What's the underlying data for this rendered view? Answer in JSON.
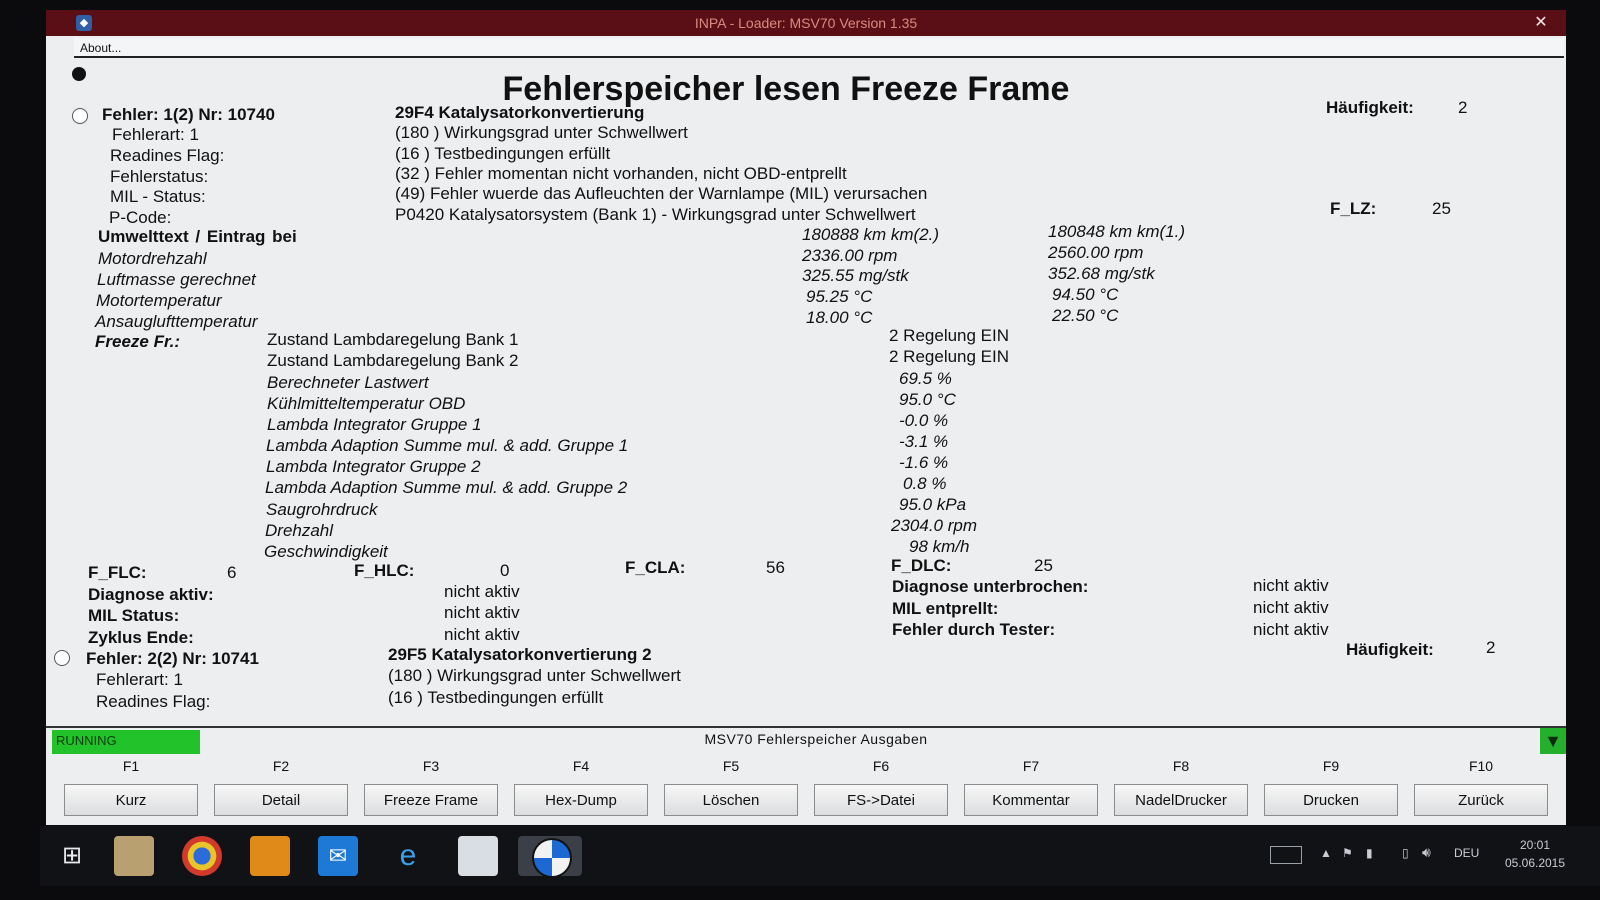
{
  "window": {
    "title": "INPA - Loader: MSV70 Version 1.35",
    "menu": {
      "about": "About..."
    }
  },
  "page_title": "Fehlerspeicher lesen Freeze Frame",
  "fault1": {
    "header": "Fehler: 1(2) Nr: 10740",
    "code_text": "29F4 Katalysatorkonvertierung",
    "haeufigkeit_label": "Häufigkeit:",
    "haeufigkeit_value": "2",
    "flz_label": "F_LZ:",
    "flz_value": "25",
    "rows": [
      {
        "label": "Fehlerart: 1",
        "value": "(180 ) Wirkungsgrad unter Schwellwert"
      },
      {
        "label": "Readines Flag:",
        "value": "(16 ) Testbedingungen erfüllt"
      },
      {
        "label": "Fehlerstatus:",
        "value": "(32 ) Fehler momentan nicht vorhanden, nicht OBD-entprellt"
      },
      {
        "label": "MIL - Status:",
        "value": "(49) Fehler wuerde das Aufleuchten der Warnlampe (MIL) verursachen"
      },
      {
        "label": "P-Code:",
        "value": "P0420 Katalysatorsystem (Bank 1) - Wirkungsgrad unter Schwellwert"
      }
    ],
    "umwelt_header": "Umwelttext  /  Eintrag bei",
    "km_col1": "180888 km km(2.)",
    "km_col2": "180848 km km(1.)",
    "umwelt": [
      {
        "label": "Motordrehzahl",
        "v1": "2336.00 rpm",
        "v2": "2560.00 rpm"
      },
      {
        "label": "Luftmasse gerechnet",
        "v1": "325.55 mg/stk",
        "v2": "352.68 mg/stk"
      },
      {
        "label": "Motortemperatur",
        "v1": "95.25 °C",
        "v2": "94.50 °C"
      },
      {
        "label": "Ansauglufttemperatur",
        "v1": "18.00 °C",
        "v2": "22.50 °C"
      }
    ],
    "freeze_label": "Freeze Fr.:",
    "freeze": [
      {
        "label": "Zustand Lambdaregelung Bank 1",
        "value": "2 Regelung EIN",
        "italic": false
      },
      {
        "label": "Zustand Lambdaregelung Bank 2",
        "value": "2 Regelung EIN",
        "italic": false
      },
      {
        "label": "Berechneter Lastwert",
        "value": "69.5 %",
        "italic": true
      },
      {
        "label": "Kühlmitteltemperatur OBD",
        "value": "95.0 °C",
        "italic": true
      },
      {
        "label": "Lambda Integrator Gruppe 1",
        "value": "-0.0 %",
        "italic": true
      },
      {
        "label": "Lambda Adaption Summe mul. & add. Gruppe 1",
        "value": "-3.1 %",
        "italic": true
      },
      {
        "label": "Lambda Integrator Gruppe 2",
        "value": "-1.6 %",
        "italic": true
      },
      {
        "label": "Lambda Adaption Summe mul. & add. Gruppe 2",
        "value": "0.8 %",
        "italic": true
      },
      {
        "label": "Saugrohrdruck",
        "value": "95.0 kPa",
        "italic": true
      },
      {
        "label": "Drehzahl",
        "value": "2304.0 rpm",
        "italic": true
      },
      {
        "label": "Geschwindigkeit",
        "value": "98 km/h",
        "italic": true
      }
    ],
    "counters": {
      "flc_label": "F_FLC:",
      "flc_value": "6",
      "hlc_label": "F_HLC:",
      "hlc_value": "0",
      "cla_label": "F_CLA:",
      "cla_value": "56",
      "dlc_label": "F_DLC:",
      "dlc_value": "25"
    },
    "status_left": [
      {
        "label": "Diagnose aktiv:",
        "value": "nicht aktiv"
      },
      {
        "label": "MIL Status:",
        "value": "nicht aktiv"
      },
      {
        "label": "Zyklus Ende:",
        "value": "nicht aktiv"
      }
    ],
    "status_right": [
      {
        "label": "Diagnose unterbrochen:",
        "value": "nicht aktiv"
      },
      {
        "label": "MIL entprellt:",
        "value": "nicht aktiv"
      },
      {
        "label": "Fehler durch Tester:",
        "value": "nicht aktiv"
      }
    ]
  },
  "fault2": {
    "header": "Fehler: 2(2) Nr: 10741",
    "code_text": "29F5 Katalysatorkonvertierung 2",
    "haeufigkeit_label": "Häufigkeit:",
    "haeufigkeit_value": "2",
    "rows": [
      {
        "label": "Fehlerart: 1",
        "value": "(180 ) Wirkungsgrad unter Schwellwert"
      },
      {
        "label": "Readines Flag:",
        "value": "(16 ) Testbedingungen erfüllt"
      }
    ]
  },
  "status_bar": {
    "running": "RUNNING",
    "title": "MSV70 Fehlerspeicher Ausgaben"
  },
  "fkeys": [
    {
      "key": "F1",
      "label": "Kurz"
    },
    {
      "key": "F2",
      "label": "Detail"
    },
    {
      "key": "F3",
      "label": "Freeze Frame"
    },
    {
      "key": "F4",
      "label": "Hex-Dump"
    },
    {
      "key": "F5",
      "label": "Löschen"
    },
    {
      "key": "F6",
      "label": "FS->Datei"
    },
    {
      "key": "F7",
      "label": "Kommentar"
    },
    {
      "key": "F8",
      "label": "NadelDrucker"
    },
    {
      "key": "F9",
      "label": "Drucken"
    },
    {
      "key": "F10",
      "label": "Zurück"
    }
  ],
  "taskbar": {
    "language": "DEU",
    "time": "20:01",
    "date": "05.06.2015"
  }
}
